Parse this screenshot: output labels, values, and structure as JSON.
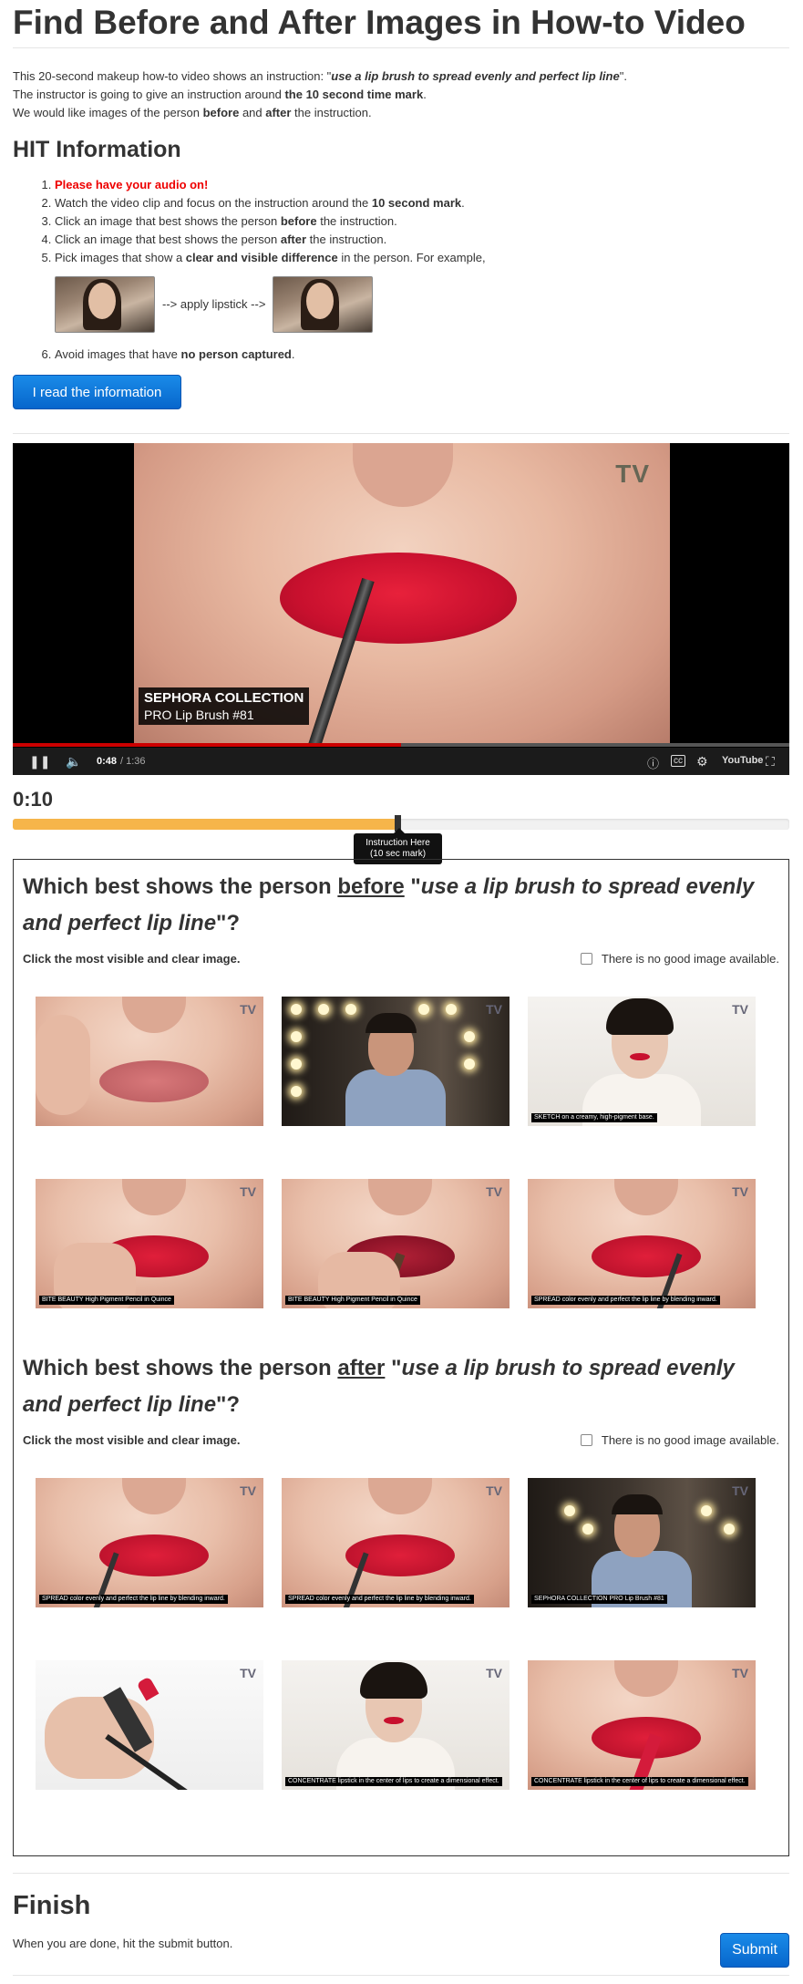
{
  "header": {
    "title": "Find Before and After Images in How-to Video"
  },
  "intro": {
    "line1_pre": "This 20-second makeup how-to video shows an instruction: \"",
    "instruction": "use a lip brush to spread evenly and perfect lip line",
    "line1_post": "\".",
    "line2_pre": "The instructor is going to give an instruction around ",
    "line2_bold": "the 10 second time mark",
    "line2_post": ".",
    "line3_pre": "We would like images of the person ",
    "line3_b1": "before",
    "line3_mid": " and ",
    "line3_b2": "after",
    "line3_post": " the instruction."
  },
  "hit": {
    "heading": "HIT Information",
    "step1": "Please have your audio on!",
    "step2_pre": "Watch the video clip and focus on the instruction around the ",
    "step2_bold": "10 second mark",
    "step2_post": ".",
    "step3_pre": "Click an image that best shows the person ",
    "step3_bold": "before",
    "step3_post": " the instruction.",
    "step4_pre": "Click an image that best shows the person ",
    "step4_bold": "after",
    "step4_post": " the instruction.",
    "step5_pre": "Pick images that show a ",
    "step5_bold": "clear and visible difference",
    "step5_post": " in the person. For example,",
    "example_arrow": "--> apply lipstick -->",
    "step6_pre": "Avoid images that have ",
    "step6_bold": "no person captured",
    "step6_post": ".",
    "read_button": "I read the information"
  },
  "video": {
    "watermark": "TV",
    "caption_title": "SEPHORA COLLECTION",
    "caption_sub": "PRO Lip Brush #81",
    "current_time": "0:48",
    "duration": "/ 1:36",
    "progress_fraction": 0.5,
    "youtube_label": "YouTube"
  },
  "timer": {
    "value": "0:10",
    "fill_fraction": 0.5,
    "tooltip_line1": "Instruction Here",
    "tooltip_line2": "(10 sec mark)"
  },
  "before": {
    "q_pre": "Which best shows the person ",
    "q_word": "before",
    "q_mid": " \"",
    "q_instr": "use a lip brush to spread evenly and perfect lip line",
    "q_post": "\"?",
    "sub": "Click the most visible and clear image.",
    "nogood": "There is no good image available.",
    "captions": [
      "",
      "",
      "SKETCH on a creamy, high-pigment base.",
      "BITE BEAUTY High Pigment Pencil in Quince",
      "BITE BEAUTY High Pigment Pencil in Quince",
      "SPREAD color evenly and perfect the lip line by blending inward."
    ]
  },
  "after": {
    "q_pre": "Which best shows the person ",
    "q_word": "after",
    "q_mid": " \"",
    "q_instr": "use a lip brush to spread evenly and perfect lip line",
    "q_post": "\"?",
    "sub": "Click the most visible and clear image.",
    "nogood": "There is no good image available.",
    "captions": [
      "SPREAD color evenly and perfect the lip line by blending inward.",
      "SPREAD color evenly and perfect the lip line by blending inward.",
      "SEPHORA COLLECTION PRO Lip Brush #81",
      "",
      "CONCENTRATE lipstick in the center of lips to create a dimensional effect.",
      "CONCENTRATE lipstick in the center of lips to create a dimensional effect."
    ]
  },
  "finish": {
    "heading": "Finish",
    "text": "When you are done, hit the submit button.",
    "submit": "Submit"
  },
  "colors": {
    "accent_blue": "#0766cc",
    "progress_orange": "#f6b54a",
    "alert_red": "#ee0000"
  }
}
